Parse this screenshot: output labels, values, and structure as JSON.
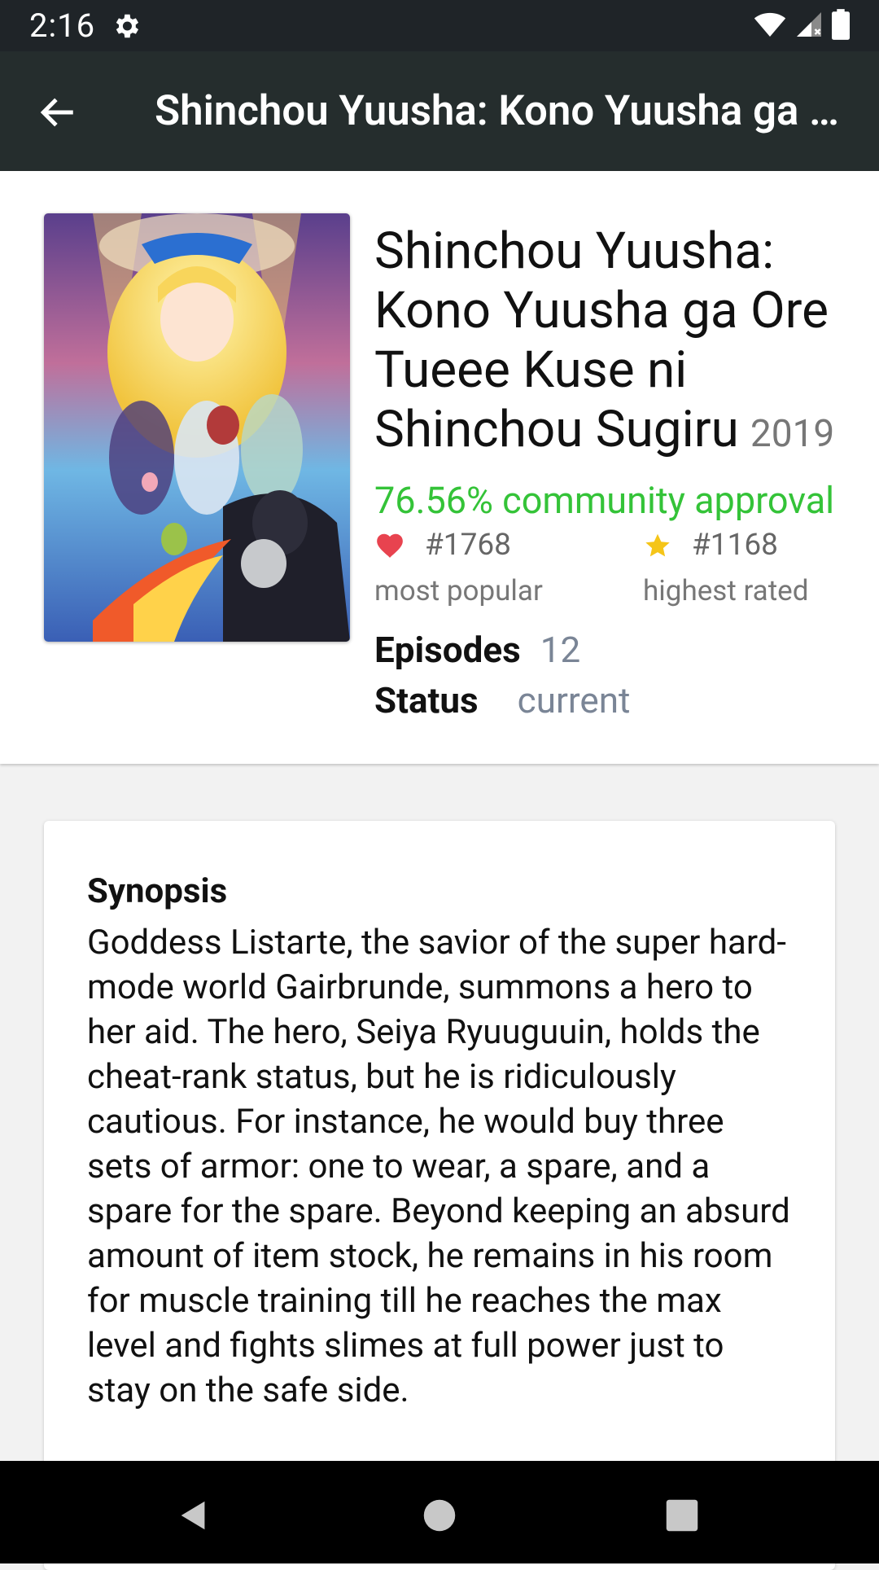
{
  "status_bar": {
    "time": "2:16"
  },
  "app_bar": {
    "title": "Shinchou Yuusha: Kono Yuusha ga Ore Tueee Kuse ni Shinchou Sugiru"
  },
  "anime": {
    "title": "Shinchou Yuusha: Kono Yuusha ga Ore Tueee Kuse ni Shinchou Sugiru",
    "year": "2019",
    "approval": "76.56% community approval",
    "popular_rank": "#1768",
    "popular_label": "most popular",
    "rated_rank": "#1168",
    "rated_label": "highest rated",
    "episodes_label": "Episodes",
    "episodes_value": "12",
    "status_label": "Status",
    "status_value": "current"
  },
  "synopsis": {
    "heading": "Synopsis",
    "text": "Goddess Listarte, the savior of the super hard-mode world Gairbrunde, summons a hero to her aid. The hero, Seiya Ryuuguuin, holds the cheat-rank status, but he is ridiculously cautious. For instance, he would buy three sets of armor: one to wear, a spare, and a spare for the spare. Beyond keeping an absurd amount of item stock, he remains in his room for muscle training till he reaches the max level and fights slimes at full power just to stay on the safe side."
  },
  "colors": {
    "approval": "#34c338",
    "heart": "#e8434f",
    "star": "#f5c518",
    "app_bar": "#252d2d"
  },
  "icons": {
    "settings": "gear-icon",
    "wifi": "wifi-icon",
    "signal": "signal-icon",
    "battery": "battery-icon",
    "back": "arrow-left-icon",
    "popular": "heart-icon",
    "rated": "star-icon",
    "nav_back": "triangle-back-icon",
    "nav_home": "circle-home-icon",
    "nav_recents": "square-recents-icon"
  }
}
